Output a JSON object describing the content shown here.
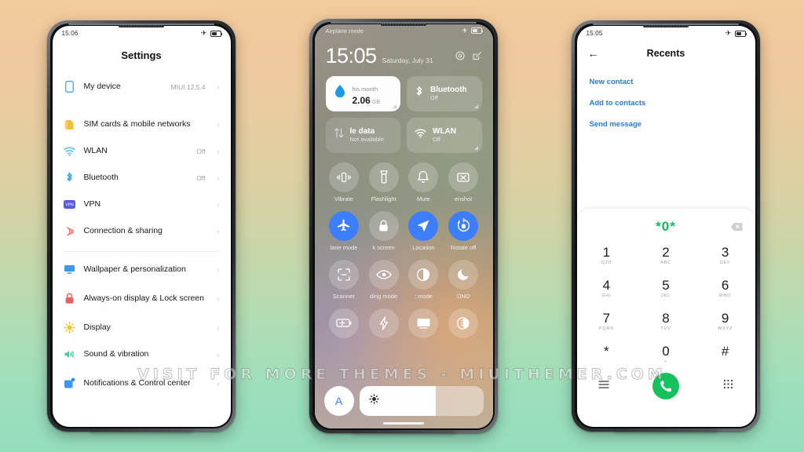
{
  "background": {
    "top_color": "#f3cb9d",
    "bottom_color": "#94debd"
  },
  "watermark": {
    "text": "VISIT FOR MORE THEMES - MIUITHEMER.COM"
  },
  "phone1": {
    "status": {
      "time": "15:06",
      "airplane_icon": "airplane-icon",
      "battery_icon": "battery-icon"
    },
    "title": "Settings",
    "groups": [
      {
        "items": [
          {
            "icon": "device-icon",
            "label": "My device",
            "value": "MIUI 12.5.4",
            "chevron": "›"
          }
        ]
      },
      {
        "items": [
          {
            "icon": "sim-card-icon",
            "label": "SIM cards & mobile networks",
            "value": "",
            "chevron": "›"
          },
          {
            "icon": "wifi-icon",
            "label": "WLAN",
            "value": "Off",
            "chevron": "›"
          },
          {
            "icon": "bluetooth-icon",
            "label": "Bluetooth",
            "value": "Off",
            "chevron": "›"
          },
          {
            "icon": "vpn-icon",
            "label": "VPN",
            "value": "",
            "chevron": "›"
          },
          {
            "icon": "connection-sharing-icon",
            "label": "Connection & sharing",
            "value": "",
            "chevron": "›"
          }
        ]
      },
      {
        "items": [
          {
            "icon": "wallpaper-icon",
            "label": "Wallpaper & personalization",
            "value": "",
            "chevron": "›"
          },
          {
            "icon": "lock-icon",
            "label": "Always-on display & Lock screen",
            "value": "",
            "chevron": "›"
          },
          {
            "icon": "display-icon",
            "label": "Display",
            "value": "",
            "chevron": "›"
          },
          {
            "icon": "sound-icon",
            "label": "Sound & vibration",
            "value": "",
            "chevron": "›"
          },
          {
            "icon": "notifications-icon",
            "label": "Notifications & Control center",
            "value": "",
            "chevron": "›"
          }
        ]
      }
    ]
  },
  "phone2": {
    "status": {
      "label": "Airplane mode",
      "airplane_icon": "airplane-icon",
      "battery_icon": "battery-icon"
    },
    "clock": {
      "time": "15:05",
      "date": "Saturday, July 31"
    },
    "header_icons": [
      "settings-gear-icon",
      "edit-icon"
    ],
    "cards": [
      {
        "icon": "data-usage-icon",
        "title": "2.06",
        "unit": "GB",
        "sub": "This month",
        "style": "white",
        "clipped_sub": "his month"
      },
      {
        "icon": "bluetooth-icon",
        "title": "Bluetooth",
        "sub": "Off",
        "style": "tint"
      },
      {
        "icon": "mobile-data-icon",
        "title": "le data",
        "sub": "Not available",
        "style": "dim"
      },
      {
        "icon": "wifi-icon",
        "title": "WLAN",
        "sub": "Off",
        "style": "tint"
      }
    ],
    "toggles": [
      {
        "icon": "vibrate-icon",
        "label": "Vibrate",
        "on": false
      },
      {
        "icon": "flashlight-icon",
        "label": "Flashlight",
        "on": false
      },
      {
        "icon": "mute-bell-icon",
        "label": "Mute",
        "on": false
      },
      {
        "icon": "screenshot-icon",
        "label": "enshot",
        "on": false
      },
      {
        "icon": "airplane-icon",
        "label": "lane mode",
        "on": true
      },
      {
        "icon": "lock-screen-icon",
        "label": "k screen",
        "on": false
      },
      {
        "icon": "location-icon",
        "label": "Location",
        "on": true
      },
      {
        "icon": "rotate-icon",
        "label": "Rotate off",
        "on": true
      },
      {
        "icon": "scanner-icon",
        "label": "Scanner",
        "on": false
      },
      {
        "icon": "reading-mode-icon",
        "label": "ding mode",
        "on": false
      },
      {
        "icon": "dark-mode-icon",
        "label": ": mode",
        "on": false
      },
      {
        "icon": "dnd-moon-icon",
        "label": "DND",
        "on": false
      },
      {
        "icon": "battery-saver-icon",
        "label": "",
        "on": false
      },
      {
        "icon": "lightning-icon",
        "label": "",
        "on": false
      },
      {
        "icon": "cast-icon",
        "label": "",
        "on": false
      },
      {
        "icon": "contrast-icon",
        "label": "",
        "on": false
      }
    ],
    "brightness": {
      "auto_label": "A",
      "icon": "brightness-icon",
      "level_percent": 62
    }
  },
  "phone3": {
    "status": {
      "time": "15:05",
      "airplane_icon": "airplane-icon",
      "battery_icon": "battery-icon"
    },
    "back_icon": "back-arrow-icon",
    "title": "Recents",
    "links": [
      "New contact",
      "Add to contacts",
      "Send message"
    ],
    "dialer": {
      "number": "*0*",
      "delete_icon": "backspace-icon",
      "keys": [
        {
          "digit": "1",
          "letters": "QJD"
        },
        {
          "digit": "2",
          "letters": "ABC"
        },
        {
          "digit": "3",
          "letters": "DEF"
        },
        {
          "digit": "4",
          "letters": "GHI"
        },
        {
          "digit": "5",
          "letters": "JKL"
        },
        {
          "digit": "6",
          "letters": "MNO"
        },
        {
          "digit": "7",
          "letters": "PQRS"
        },
        {
          "digit": "8",
          "letters": "TUV"
        },
        {
          "digit": "9",
          "letters": "WXYZ"
        },
        {
          "digit": "*",
          "letters": ""
        },
        {
          "digit": "0",
          "letters": "+"
        },
        {
          "digit": "#",
          "letters": ""
        }
      ],
      "actions": [
        "menu-icon",
        "call-icon",
        "keypad-icon"
      ]
    }
  }
}
